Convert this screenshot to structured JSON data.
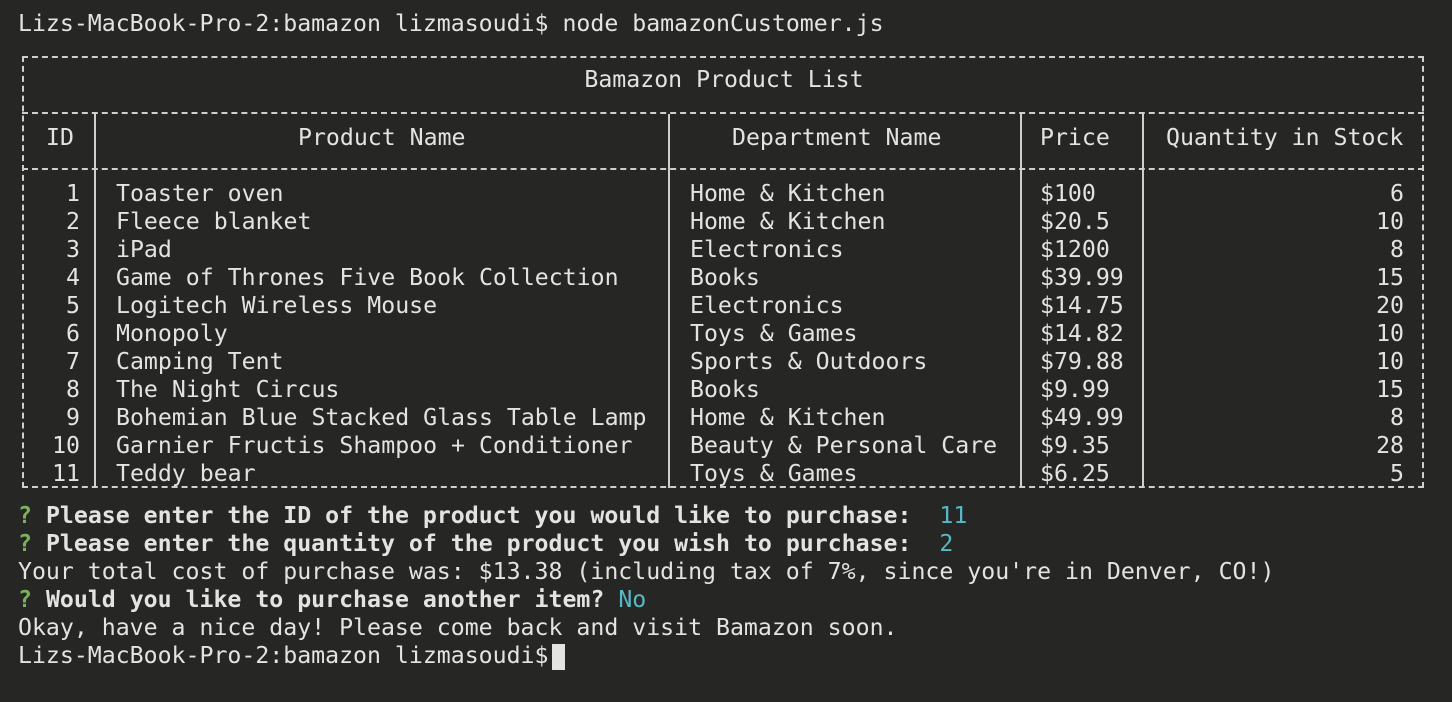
{
  "prompt": {
    "host": "Lizs-MacBook-Pro-2:bamazon lizmasoudi$",
    "command": "node bamazonCustomer.js"
  },
  "table": {
    "title": "Bamazon Product List",
    "headers": [
      "ID",
      "Product Name",
      "Department Name",
      "Price",
      "Quantity in Stock"
    ],
    "rows": [
      [
        "1",
        "Toaster oven",
        "Home & Kitchen",
        "$100",
        "6"
      ],
      [
        "2",
        "Fleece blanket",
        "Home & Kitchen",
        "$20.5",
        "10"
      ],
      [
        "3",
        "iPad",
        "Electronics",
        "$1200",
        "8"
      ],
      [
        "4",
        "Game of Thrones Five Book Collection",
        "Books",
        "$39.99",
        "15"
      ],
      [
        "5",
        "Logitech Wireless Mouse",
        "Electronics",
        "$14.75",
        "20"
      ],
      [
        "6",
        "Monopoly",
        "Toys & Games",
        "$14.82",
        "10"
      ],
      [
        "7",
        "Camping Tent",
        "Sports & Outdoors",
        "$79.88",
        "10"
      ],
      [
        "8",
        "The Night Circus",
        "Books",
        "$9.99",
        "15"
      ],
      [
        "9",
        "Bohemian Blue Stacked Glass Table Lamp",
        "Home & Kitchen",
        "$49.99",
        "8"
      ],
      [
        "10",
        "Garnier Fructis Shampoo + Conditioner",
        "Beauty & Personal Care",
        "$9.35",
        "28"
      ],
      [
        "11",
        "Teddy bear",
        "Toys & Games",
        "$6.25",
        "5"
      ]
    ]
  },
  "dialog": {
    "q1": {
      "mark": "?",
      "text": "Please enter the ID of the product you would like to purchase:",
      "answer": "11"
    },
    "q2": {
      "mark": "?",
      "text": "Please enter the quantity of the product you wish to purchase:",
      "answer": "2"
    },
    "total": "Your total cost of purchase was: $13.38 (including tax of 7%, since you're in Denver, CO!)",
    "q3": {
      "mark": "?",
      "text": "Would you like to purchase another item?",
      "answer": "No"
    },
    "goodbye": "Okay, have a nice day! Please come back and visit Bamazon soon."
  },
  "colors": {
    "background": "#262625",
    "text": "#e3e3e1",
    "question_mark": "#7bb35a",
    "answer": "#57b9c6"
  }
}
